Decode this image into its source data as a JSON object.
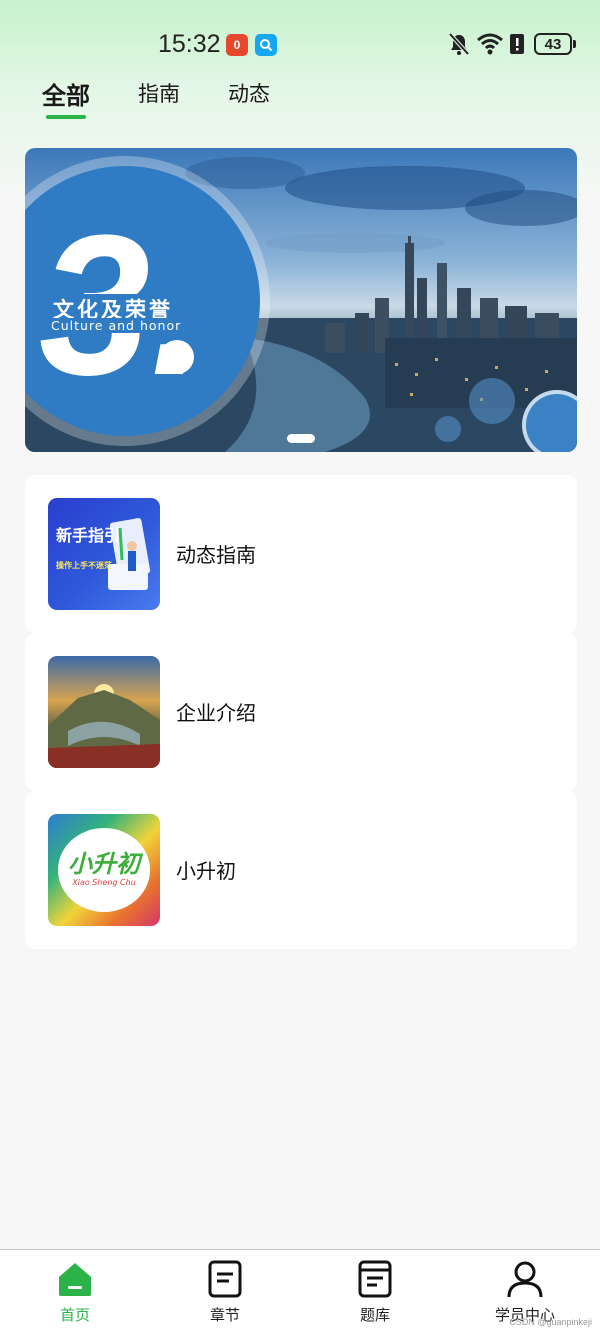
{
  "status_bar": {
    "time": "15:32",
    "notifications": [
      "0",
      "Q"
    ],
    "battery": "43"
  },
  "tabs": [
    {
      "label": "全部",
      "active": true
    },
    {
      "label": "指南",
      "active": false
    },
    {
      "label": "动态",
      "active": false
    }
  ],
  "banner": {
    "number": "3.",
    "title": "文化及荣誉",
    "subtitle": "Culture and honor"
  },
  "list": [
    {
      "label": "动态指南",
      "thumb_text_1": "新手指引",
      "thumb_text_2": "操作上手不迷茫"
    },
    {
      "label": "企业介绍"
    },
    {
      "label": "小升初",
      "thumb_text_1": "小升初",
      "thumb_text_2": "Xiao Sheng Chu"
    }
  ],
  "bottom_nav": [
    {
      "label": "首页",
      "icon": "home-icon",
      "active": true
    },
    {
      "label": "章节",
      "icon": "chapter-icon",
      "active": false
    },
    {
      "label": "题库",
      "icon": "question-bank-icon",
      "active": false
    },
    {
      "label": "学员中心",
      "icon": "user-icon",
      "active": false
    }
  ],
  "watermark": "CSDN @guanpinkeji",
  "colors": {
    "accent": "#2bb34a",
    "banner_blue": "#2f7cc4",
    "background": "#f6f7f6"
  }
}
